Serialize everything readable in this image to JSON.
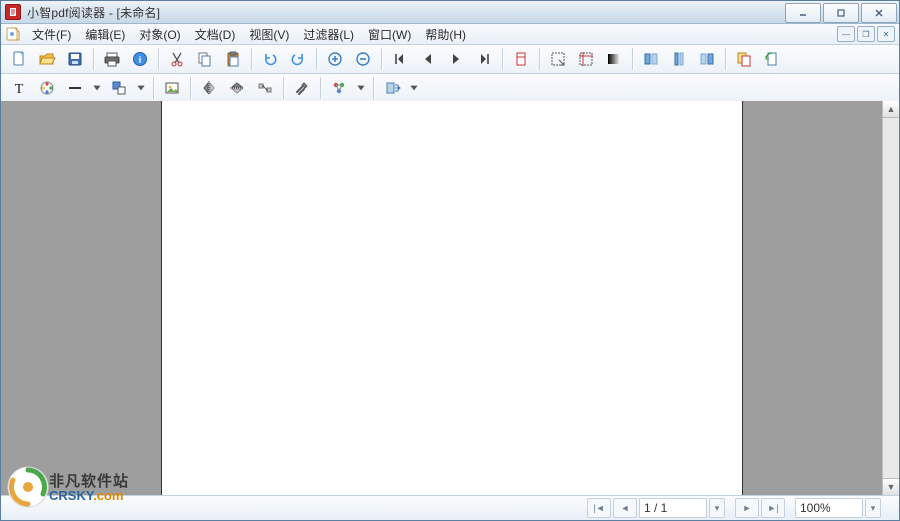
{
  "title": "小智pdf阅读器 - [未命名]",
  "menu": {
    "file": "文件(F)",
    "edit": "编辑(E)",
    "object": "对象(O)",
    "document": "文档(D)",
    "view": "视图(V)",
    "filter": "过滤器(L)",
    "window": "窗口(W)",
    "help": "帮助(H)"
  },
  "status": {
    "page": "1 / 1",
    "zoom": "100%"
  },
  "watermark": {
    "cn": "非凡软件站",
    "en_main": "CRSKY",
    "en_ext": ".com"
  }
}
